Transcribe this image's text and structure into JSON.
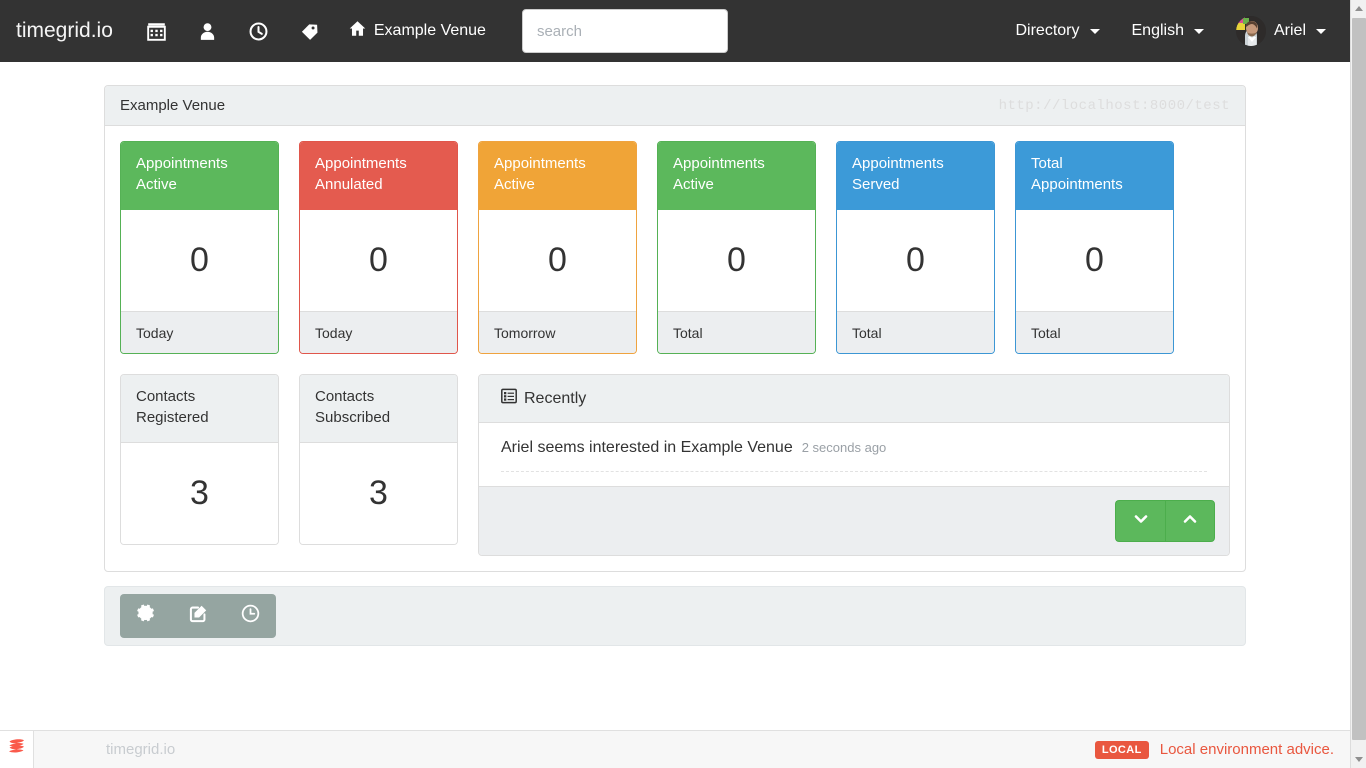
{
  "navbar": {
    "brand": "timegrid.io",
    "icons": [
      {
        "name": "calendar-icon",
        "label": "Calendar"
      },
      {
        "name": "user-icon",
        "label": "Contacts"
      },
      {
        "name": "clock-icon",
        "label": "Schedule"
      },
      {
        "name": "tag-icon",
        "label": "Services"
      }
    ],
    "venue": "Example Venue",
    "search_placeholder": "search",
    "search_value": "",
    "directory": "Directory",
    "language": "English",
    "user": "Ariel"
  },
  "panel": {
    "title": "Example Venue",
    "url": "http://localhost:8000/test"
  },
  "stats": [
    {
      "title_line1": "Appointments",
      "title_line2": "Active",
      "value": "0",
      "footer": "Today",
      "color": "green",
      "hex": "#5cb85c"
    },
    {
      "title_line1": "Appointments",
      "title_line2": "Annulated",
      "value": "0",
      "footer": "Today",
      "color": "red",
      "hex": "#e45b4f"
    },
    {
      "title_line1": "Appointments",
      "title_line2": "Active",
      "value": "0",
      "footer": "Tomorrow",
      "color": "orange",
      "hex": "#f0a437"
    },
    {
      "title_line1": "Appointments",
      "title_line2": "Active",
      "value": "0",
      "footer": "Total",
      "color": "green",
      "hex": "#5cb85c"
    },
    {
      "title_line1": "Appointments",
      "title_line2": "Served",
      "value": "0",
      "footer": "Total",
      "color": "blue",
      "hex": "#3c9ad8"
    },
    {
      "title_line1": "Total",
      "title_line2": "Appointments",
      "value": "0",
      "footer": "Total",
      "color": "blue",
      "hex": "#3c9ad8"
    }
  ],
  "contacts": [
    {
      "title_line1": "Contacts",
      "title_line2": "Registered",
      "value": "3"
    },
    {
      "title_line1": "Contacts",
      "title_line2": "Subscribed",
      "value": "3"
    }
  ],
  "recently": {
    "heading": "Recently",
    "heading_icon": "list-alt-icon",
    "items": [
      {
        "text": "Ariel seems interested in Example Venue",
        "time": "2 seconds ago"
      }
    ],
    "buttons": [
      {
        "name": "chevron-down-button",
        "icon": "chevron-down-icon"
      },
      {
        "name": "chevron-up-button",
        "icon": "chevron-up-icon"
      }
    ]
  },
  "toolbar": [
    {
      "name": "settings-button",
      "icon": "gear-icon"
    },
    {
      "name": "edit-button",
      "icon": "pencil-square-icon"
    },
    {
      "name": "schedule-button",
      "icon": "clock-icon"
    }
  ],
  "footer": {
    "brand": "timegrid.io",
    "badge": "LOCAL",
    "advice": "Local environment advice."
  }
}
